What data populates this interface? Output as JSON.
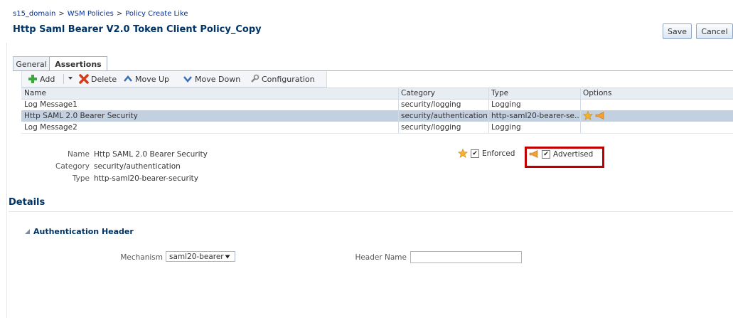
{
  "breadcrumb": {
    "items": [
      "s15_domain",
      "WSM Policies",
      "Policy Create Like"
    ],
    "separator": ">"
  },
  "page_title": "Http Saml Bearer V2.0 Token Client Policy_Copy",
  "actions": {
    "save": "Save",
    "cancel": "Cancel"
  },
  "tabs": [
    {
      "label": "General"
    },
    {
      "label": "Assertions",
      "active": true
    }
  ],
  "toolbar": {
    "add": "Add",
    "delete": "Delete",
    "move_up": "Move Up",
    "move_down": "Move Down",
    "configuration": "Configuration"
  },
  "table": {
    "columns": [
      "Name",
      "Category",
      "Type",
      "Options"
    ],
    "rows": [
      {
        "name": "Log Message1",
        "category": "security/logging",
        "type": "Logging",
        "options": []
      },
      {
        "name": "Http SAML 2.0 Bearer Security",
        "category": "security/authentication",
        "type": "http-saml20-bearer-se...",
        "options": [
          "star-icon",
          "megaphone-icon"
        ],
        "selected": true
      },
      {
        "name": "Log Message2",
        "category": "security/logging",
        "type": "Logging",
        "options": []
      }
    ]
  },
  "summary": {
    "name_label": "Name",
    "name_value": "Http SAML 2.0 Bearer Security",
    "category_label": "Category",
    "category_value": "security/authentication",
    "type_label": "Type",
    "type_value": "http-saml20-bearer-security",
    "enforced_label": "Enforced",
    "enforced_checked": true,
    "advertised_label": "Advertised",
    "advertised_checked": true
  },
  "details": {
    "title": "Details",
    "section": "Authentication Header",
    "mechanism_label": "Mechanism",
    "mechanism_value": "saml20-bearer",
    "header_name_label": "Header Name",
    "header_name_value": ""
  },
  "colors": {
    "title": "#003366",
    "link": "#003399",
    "selected_row": "#c3d0e0",
    "highlight_box": "#c00000"
  }
}
